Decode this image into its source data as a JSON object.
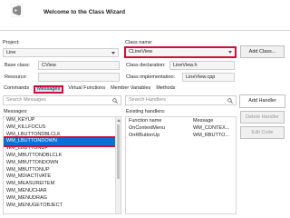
{
  "header": {
    "title": "Welcome to the Class Wizard",
    "logo_icon": "visual-studio-logo-icon"
  },
  "project": {
    "label": "Project:",
    "value": "Line"
  },
  "class_name": {
    "label": "Class name:",
    "value": "CLineView"
  },
  "add_class_button": "Add Class...",
  "base_class": {
    "label": "Base class:",
    "value": "CView"
  },
  "class_declaration": {
    "label": "Class declaration:",
    "value": "LineView.h"
  },
  "resource": {
    "label": "Resource:",
    "value": ""
  },
  "class_implementation": {
    "label": "Class implementation:",
    "value": "LineView.cpp"
  },
  "tabs": [
    {
      "label": "Commands",
      "active": false
    },
    {
      "label": "Messages",
      "active": true
    },
    {
      "label": "Virtual Functions",
      "active": false
    },
    {
      "label": "Member Variables",
      "active": false
    },
    {
      "label": "Methods",
      "active": false
    }
  ],
  "search_messages": {
    "placeholder": "Search Messages"
  },
  "search_handlers": {
    "placeholder": "Search Handlers"
  },
  "buttons": {
    "add_handler": "Add Handler",
    "delete_handler": "Delete Handler",
    "edit_code": "Edit Code"
  },
  "messages": {
    "label": "Messages:",
    "items": [
      "WM_KEYUP",
      "WM_KILLFOCUS",
      "WM_LBUTTONDBLCLK",
      "WM_LBUTTONDOWN",
      "WM_LBUTTONUP",
      "WM_MBUTTONDBLCLK",
      "WM_MBUTTONDOWN",
      "WM_MBUTTONUP",
      "WM_MDIACTIVATE",
      "WM_MEASUREITEM",
      "WM_MENUCHAR",
      "WM_MENUDRAG",
      "WM_MENUGETOBJECT"
    ],
    "selected_index": 3
  },
  "handlers": {
    "label": "Existing handlers:",
    "columns": [
      "Function name",
      "Message"
    ],
    "rows": [
      [
        "OnContextMenu",
        "WM_CONTEX..."
      ],
      [
        "OnRButtonUp",
        "WM_RBUTTO..."
      ]
    ]
  },
  "colors": {
    "highlight": "#d0103a",
    "selection": "#0a6fd6",
    "tab_active": "#cfe6f7"
  }
}
